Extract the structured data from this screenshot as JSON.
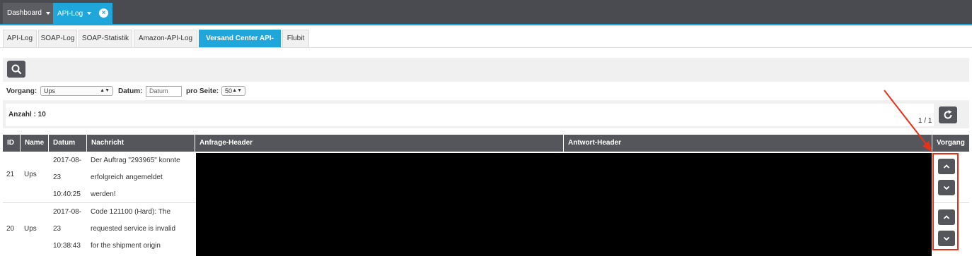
{
  "topbar": {
    "tabs": [
      {
        "label": "Dashboard"
      },
      {
        "label": "API-Log"
      }
    ],
    "close_icon": "×"
  },
  "subtabs": [
    {
      "label": "API-Log"
    },
    {
      "label": "SOAP-Log"
    },
    {
      "label": "SOAP-Statistik"
    },
    {
      "label": "Amazon-API-Log"
    },
    {
      "label": "Versand Center API-Log"
    },
    {
      "label": "Flubit"
    }
  ],
  "filters": {
    "vorgang_label": "Vorgang:",
    "vorgang_value": "Ups",
    "datum_label": "Datum:",
    "datum_placeholder": "Datum",
    "proseite_label": "pro Seite:",
    "proseite_value": "50"
  },
  "summary": {
    "count": "Anzahl : 10",
    "pager": "1 / 1"
  },
  "table": {
    "headers": [
      "ID",
      "Name",
      "Datum",
      "Nachricht",
      "Anfrage-Header",
      "Antwort-Header",
      "Vorgang"
    ],
    "rows": [
      {
        "id": "21",
        "name": "Ups",
        "date": [
          "2017-08-",
          "23",
          "10:40:25"
        ],
        "message": [
          "Der Auftrag \"293965\" konnte",
          "erfolgreich angemeldet",
          "werden!"
        ]
      },
      {
        "id": "20",
        "name": "Ups",
        "date": [
          "2017-08-",
          "23",
          "10:38:43"
        ],
        "message": [
          "Code 121100 (Hard): The",
          "requested service is invalid",
          "for the shipment origin"
        ]
      }
    ]
  },
  "colors": {
    "accent": "#1fa7dc",
    "topbar": "#4a4b50",
    "button": "#55565b",
    "annotation": "#e8311a"
  },
  "icons": {
    "search": "search-icon",
    "refresh": "refresh-icon",
    "up": "chevron-up-icon",
    "down": "chevron-down-icon"
  }
}
